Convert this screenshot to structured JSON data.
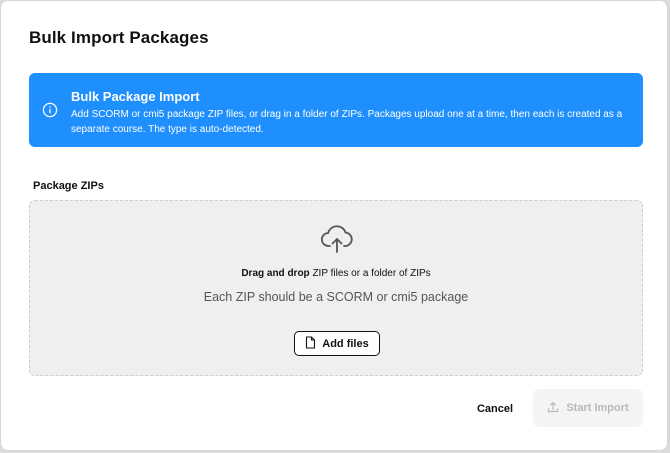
{
  "dialog": {
    "title": "Bulk Import Packages"
  },
  "banner": {
    "icon": "info-icon",
    "title": "Bulk Package Import",
    "text": "Add SCORM or cmi5 package ZIP files, or drag in a folder of ZIPs. Packages upload one at a time, then each is created as a separate course. The type is auto-detected.",
    "color": "#1e8ffc"
  },
  "dropzone": {
    "label": "Package ZIPs",
    "icon": "cloud-upload-icon",
    "instruction_bold": "Drag and drop",
    "instruction_rest": " ZIP files or a folder of ZIPs",
    "hint": "Each ZIP should be a SCORM or cmi5 package",
    "add_files_icon": "file-icon",
    "add_files_label": "Add files"
  },
  "footer": {
    "cancel_label": "Cancel",
    "start_icon": "upload-icon",
    "start_label": "Start Import"
  }
}
